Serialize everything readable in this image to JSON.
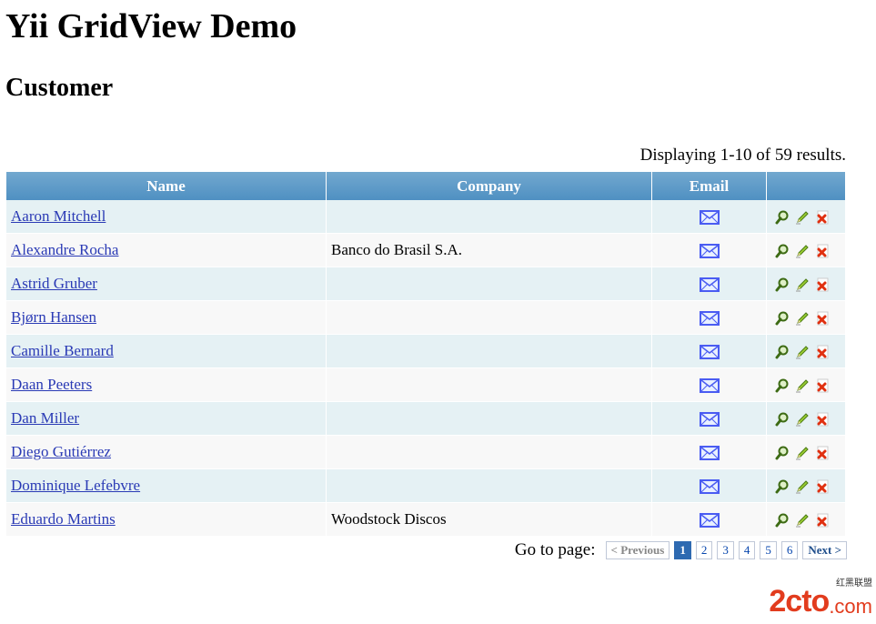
{
  "page": {
    "title": "Yii GridView Demo",
    "subtitle": "Customer",
    "summary": "Displaying 1-10 of 59 results."
  },
  "grid": {
    "headers": {
      "name": "Name",
      "company": "Company",
      "email": "Email"
    },
    "rows": [
      {
        "name": "Aaron Mitchell",
        "company": ""
      },
      {
        "name": "Alexandre Rocha",
        "company": "Banco do Brasil S.A."
      },
      {
        "name": "Astrid Gruber",
        "company": ""
      },
      {
        "name": "Bjørn Hansen",
        "company": ""
      },
      {
        "name": "Camille Bernard",
        "company": ""
      },
      {
        "name": "Daan Peeters",
        "company": ""
      },
      {
        "name": "Dan Miller",
        "company": ""
      },
      {
        "name": "Diego Gutiérrez",
        "company": ""
      },
      {
        "name": "Dominique Lefebvre",
        "company": ""
      },
      {
        "name": "Eduardo Martins",
        "company": "Woodstock Discos"
      }
    ],
    "icons": {
      "email": "envelope-icon",
      "view": "magnifier-icon",
      "update": "pencil-icon",
      "delete": "delete-icon"
    },
    "colors": {
      "header": "#5a9ccc",
      "row_odd": "#e5f1f4",
      "row_even": "#f8f8f8",
      "link": "#2a3ab5"
    }
  },
  "pager": {
    "label": "Go to page:",
    "previous": "< Previous",
    "pages": [
      "1",
      "2",
      "3",
      "4",
      "5",
      "6"
    ],
    "current_page": "1",
    "next": "Next >"
  },
  "watermark": {
    "brand": "2cto",
    "suffix": ".com",
    "tagline": "红黑联盟"
  }
}
